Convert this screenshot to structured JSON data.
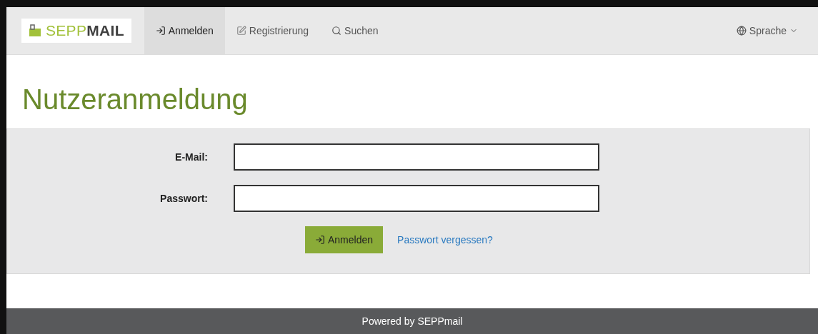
{
  "navbar": {
    "logo": {
      "part_1": "SEPP",
      "part_2": "MAIL"
    },
    "items": [
      {
        "label": "Anmelden",
        "selected": true
      },
      {
        "label": "Registrierung",
        "selected": false
      },
      {
        "label": "Suchen",
        "selected": false
      }
    ],
    "language": {
      "label": "Sprache"
    }
  },
  "heading": "Nutzeranmeldung",
  "form": {
    "fields": [
      {
        "label": "E-Mail:"
      },
      {
        "label": "Passwort:"
      }
    ],
    "submit": {
      "label": "Anmelden"
    },
    "link": "Passwort vergessen?"
  },
  "footer": "Powered by SEPPmail"
}
